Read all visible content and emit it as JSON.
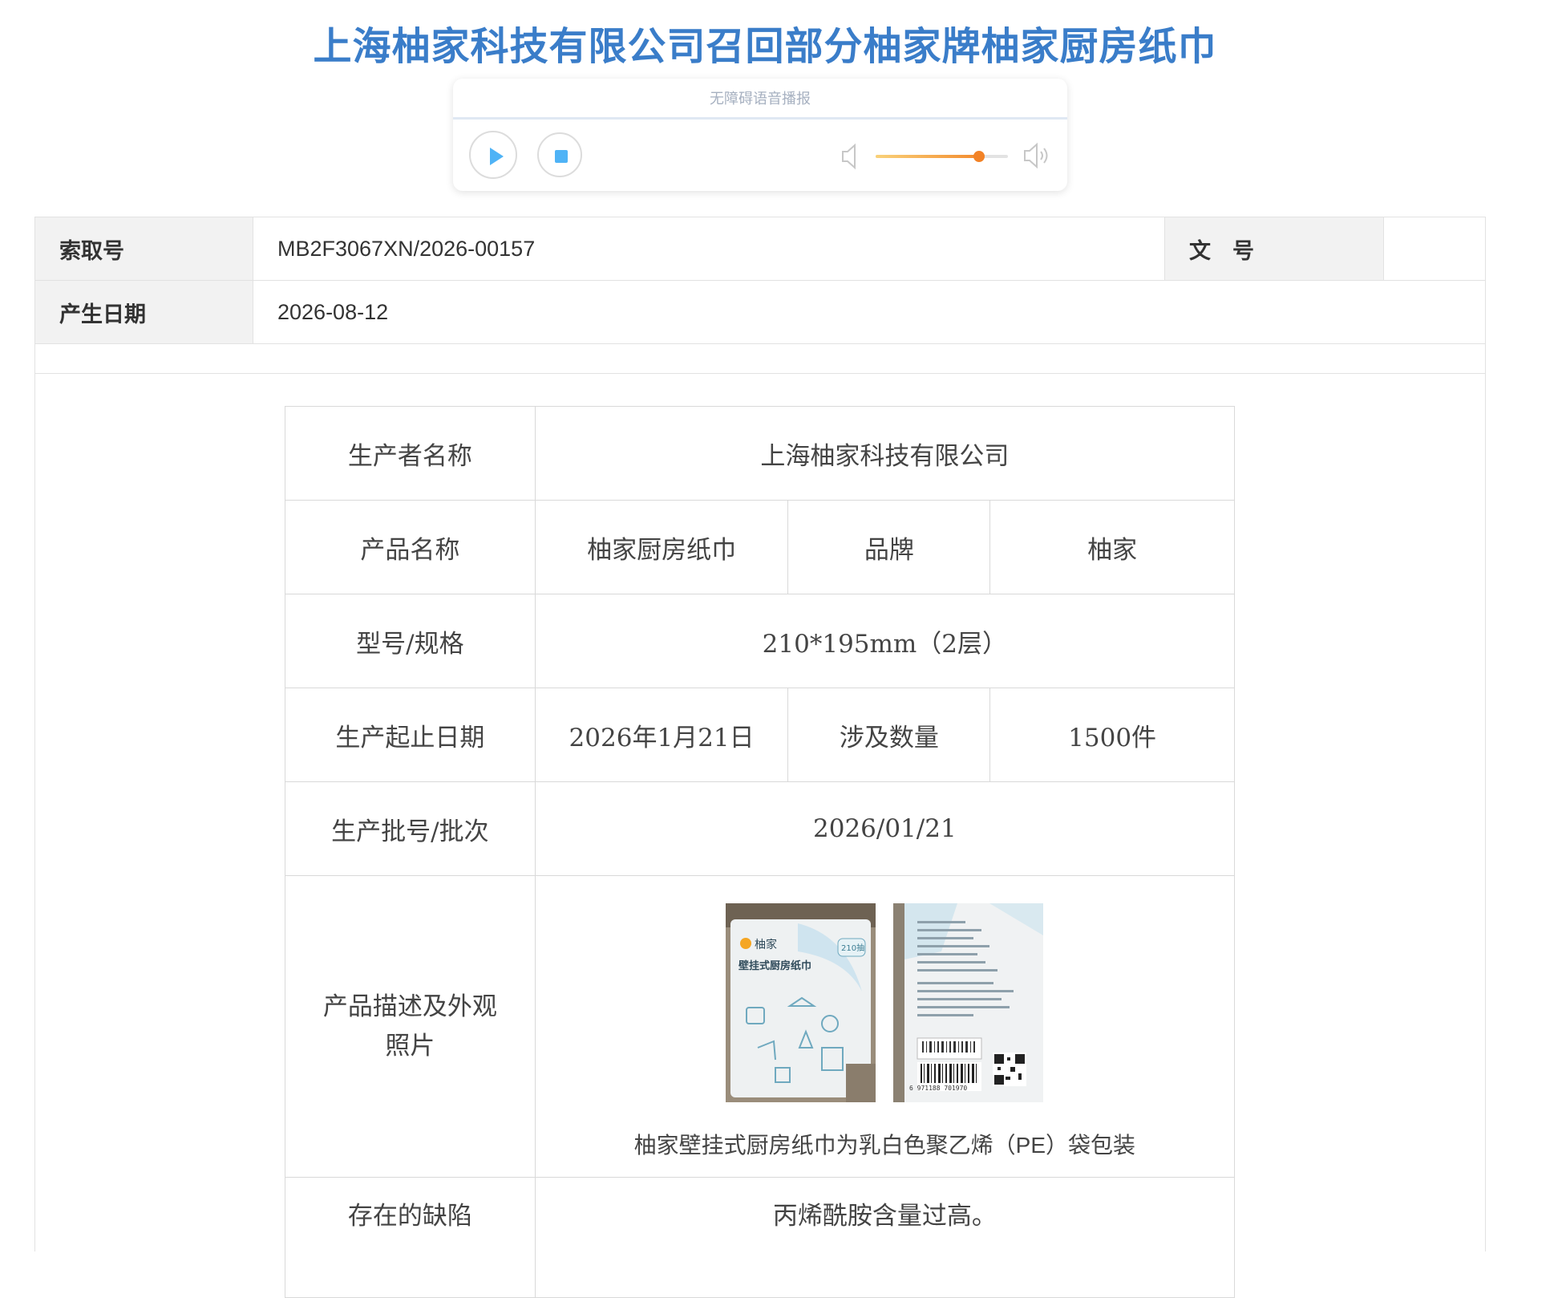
{
  "title": "上海柚家科技有限公司召回部分柚家牌柚家厨房纸巾",
  "player": {
    "label": "无障碍语音播报",
    "volume_level": 0.78
  },
  "meta": {
    "index_label": "索取号",
    "index_value": "MB2F3067XN/2026-00157",
    "doc_no_label": "文　号",
    "doc_no_value": "",
    "date_label": "产生日期",
    "date_value": "2026-08-12"
  },
  "details": {
    "producer_label": "生产者名称",
    "producer_value": "上海柚家科技有限公司",
    "product_label": "产品名称",
    "product_value": "柚家厨房纸巾",
    "brand_label": "品牌",
    "brand_value": "柚家",
    "model_label": "型号/规格",
    "model_value": "210*195mm（2层）",
    "date_range_label": "生产起止日期",
    "date_range_value": "2026年1月21日",
    "qty_label": "涉及数量",
    "qty_value": "1500件",
    "batch_label": "生产批号/批次",
    "batch_value": "2026/01/21",
    "desc_label": "产品描述及外观照片",
    "desc_caption": "柚家壁挂式厨房纸巾为乳白色聚乙烯（PE）袋包装",
    "defect_label": "存在的缺陷",
    "defect_value": "丙烯酰胺含量过高。"
  },
  "photo_front": {
    "brand_mark": "柚家",
    "product_text": "壁挂式厨房纸巾",
    "count_badge": "210抽"
  },
  "photo_back": {
    "barcode_number": "6 971188 701970"
  },
  "colors": {
    "title": "#3a7dc9",
    "player_accent": "#4fb3f6",
    "volume_fill": "#f28226",
    "label_bg": "#f2f2f2",
    "border": "#d9d9d9"
  }
}
